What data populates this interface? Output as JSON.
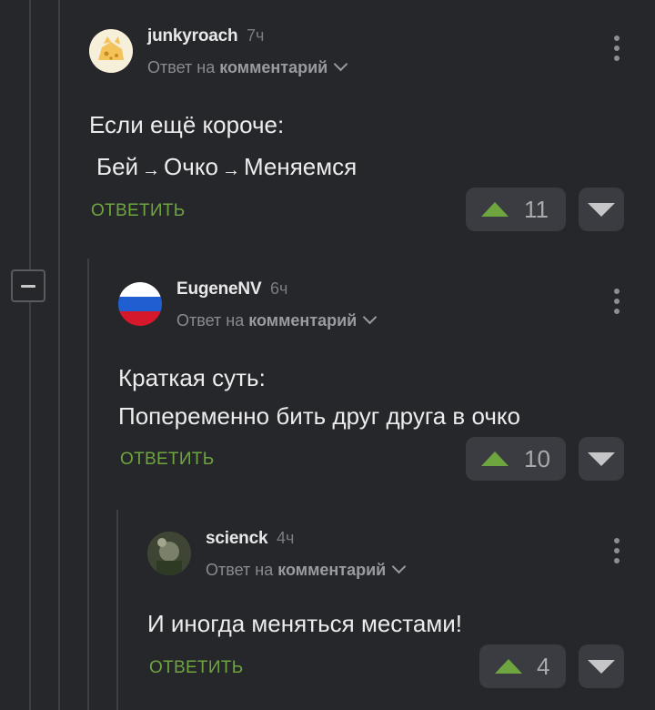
{
  "comments": [
    {
      "username": "junkyroach",
      "time": "7ч",
      "reply_prefix": "Ответ на",
      "reply_link": "комментарий",
      "text": {
        "line1": "Если ещё короче:",
        "line2_parts": [
          "Бей",
          "→",
          "Очко",
          "→",
          "Меняемся"
        ]
      },
      "reply_label": "ОТВЕТИТЬ",
      "rating": "11",
      "avatar_icon": "cheese-cat-avatar"
    },
    {
      "username": "EugeneNV",
      "time": "6ч",
      "reply_prefix": "Ответ на",
      "reply_link": "комментарий",
      "text": {
        "line1": "Краткая суть:",
        "line2": "Попеременно бить друг друга в очко"
      },
      "reply_label": "ОТВЕТИТЬ",
      "rating": "10",
      "avatar_icon": "russian-flag-avatar"
    },
    {
      "username": "scienck",
      "time": "4ч",
      "reply_prefix": "Ответ на",
      "reply_link": "комментарий",
      "text": {
        "line1": "И иногда меняться местами!"
      },
      "reply_label": "ОТВЕТИТЬ",
      "rating": "4",
      "avatar_icon": "photo-avatar"
    }
  ],
  "colors": {
    "background": "#26272b",
    "accent_green": "#6fa53f",
    "vote_bg": "#3b3c41"
  }
}
